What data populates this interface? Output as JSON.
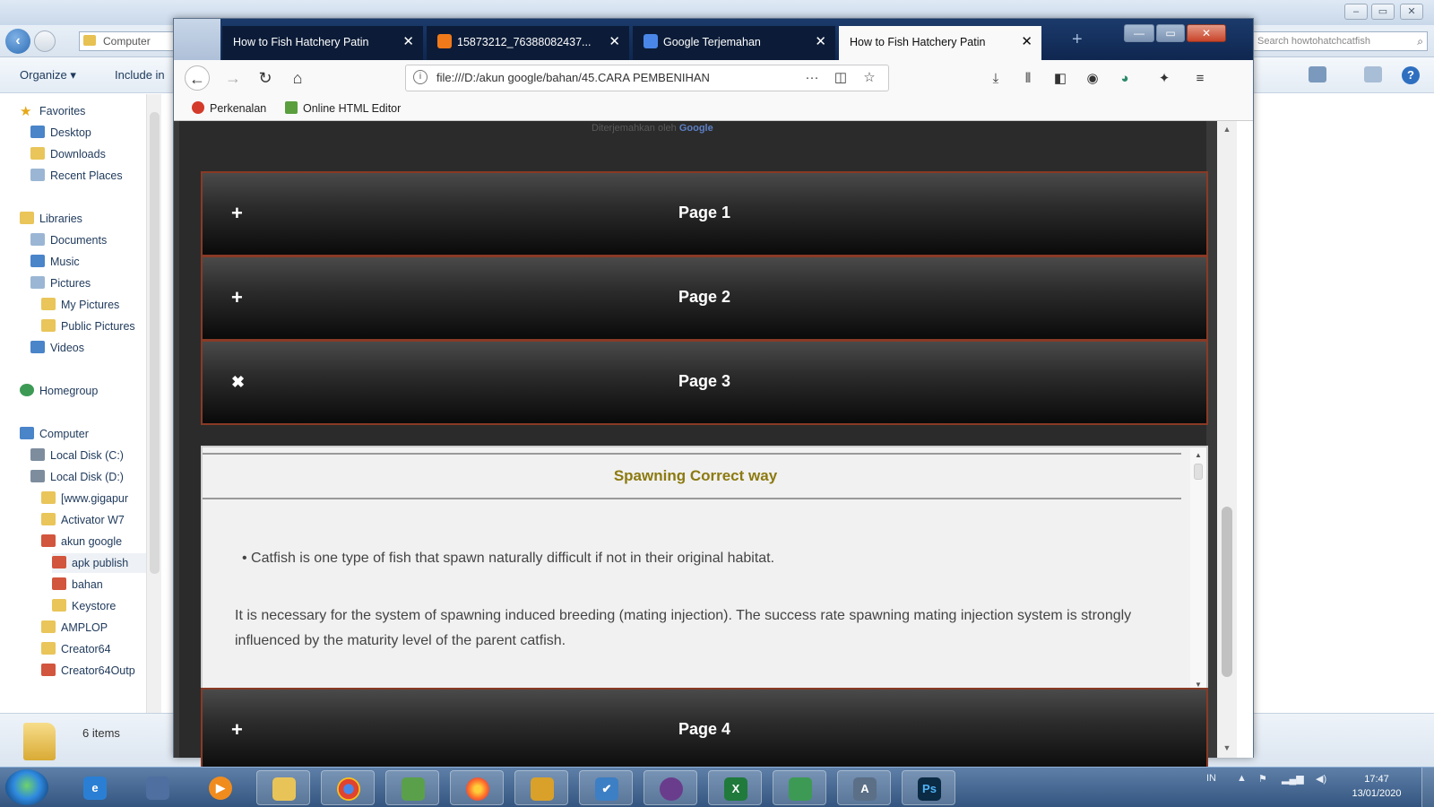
{
  "explorer": {
    "address_crumb": "Computer",
    "search_placeholder": "Search howtohatchcatfish",
    "toolbar": {
      "organize": "Organize ▾",
      "include": "Include in"
    },
    "nav": {
      "favorites": "Favorites",
      "desktop": "Desktop",
      "downloads": "Downloads",
      "recent": "Recent Places",
      "libraries": "Libraries",
      "documents": "Documents",
      "music": "Music",
      "pictures": "Pictures",
      "my_pictures": "My Pictures",
      "public_pictures": "Public Pictures",
      "videos": "Videos",
      "homegroup": "Homegroup",
      "computer": "Computer",
      "disk_c": "Local Disk (C:)",
      "disk_d": "Local Disk (D:)",
      "www": "[www.gigapur",
      "activator": "Activator W7",
      "akun_google": "akun google",
      "apk_publish": "apk publish",
      "bahan": "bahan",
      "keystore": "Keystore",
      "amplop": "AMPLOP",
      "creator64": "Creator64",
      "creator64out": "Creator64Outp"
    },
    "status_items": "6 items"
  },
  "firefox": {
    "tabs": [
      {
        "title": "How to Fish Hatchery Patin"
      },
      {
        "title": "15873212_76388082437..."
      },
      {
        "title": "Google Terjemahan"
      },
      {
        "title": "How to Fish Hatchery Patin"
      }
    ],
    "url": "file:///D:/akun google/bahan/45.CARA PEMBENIHAN",
    "bookmarks": {
      "b1": "Perkenalan",
      "b2": "Online HTML Editor"
    },
    "win_controls": {
      "min": "—",
      "max": "▭",
      "close": "✕"
    }
  },
  "page": {
    "google_credit_prefix": "Diterjemahkan oleh",
    "google_credit_brand": "Google",
    "accordion": [
      {
        "label": "Page 1",
        "icon": "+"
      },
      {
        "label": "Page 2",
        "icon": "+"
      },
      {
        "label": "Page 3",
        "icon": "✖"
      },
      {
        "label": "Page 4",
        "icon": "+"
      }
    ],
    "panel": {
      "heading": "Spawning Correct way",
      "bullet": "• Catfish is one type of fish that spawn naturally difficult if not in their original habitat.",
      "para": "It is necessary for the system of spawning induced breeding (mating injection). The success rate spawning mating injection system is strongly influenced by the maturity level of the parent catfish."
    }
  },
  "taskbar": {
    "lang": "IN",
    "time": "17:47",
    "date": "13/01/2020"
  },
  "colors": {
    "accordion_border": "#8a3a25",
    "heading_gold": "#8c7a10",
    "tab_active": "#f9f9fa"
  }
}
